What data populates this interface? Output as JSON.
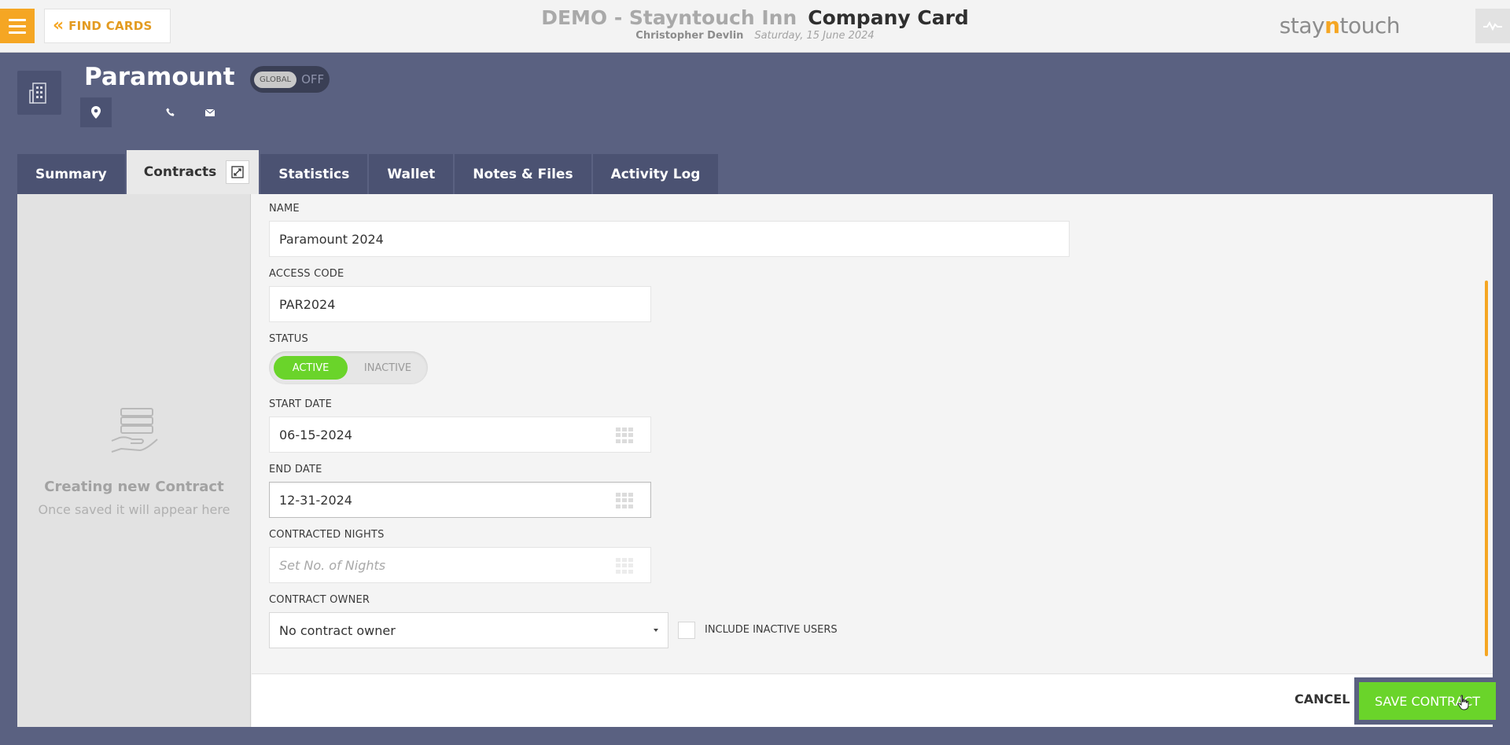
{
  "header": {
    "find_cards": "FIND CARDS",
    "hotel_name": "DEMO - Stayntouch Inn",
    "page_title": "Company Card",
    "user_name": "Christopher Devlin",
    "date": "Saturday, 15 June 2024",
    "logo_pre": "stay",
    "logo_mid": "n",
    "logo_post": "touch"
  },
  "company": {
    "name": "Paramount",
    "global_label": "GLOBAL",
    "global_state": "OFF"
  },
  "tabs": [
    {
      "label": "Summary"
    },
    {
      "label": "Contracts"
    },
    {
      "label": "Statistics"
    },
    {
      "label": "Wallet"
    },
    {
      "label": "Notes & Files"
    },
    {
      "label": "Activity Log"
    }
  ],
  "left_panel": {
    "title": "Creating new Contract",
    "subtitle": "Once saved it will appear here"
  },
  "form": {
    "name_label": "NAME",
    "name_value": "Paramount 2024",
    "access_code_label": "ACCESS CODE",
    "access_code_value": "PAR2024",
    "status_label": "STATUS",
    "status_active": "ACTIVE",
    "status_inactive": "INACTIVE",
    "start_date_label": "START DATE",
    "start_date_value": "06-15-2024",
    "end_date_label": "END DATE",
    "end_date_value": "12-31-2024",
    "nights_label": "CONTRACTED NIGHTS",
    "nights_placeholder": "Set No. of Nights",
    "owner_label": "CONTRACT OWNER",
    "owner_value": "No contract owner",
    "include_inactive_label": "INCLUDE INACTIVE USERS"
  },
  "footer": {
    "cancel": "CANCEL",
    "save": "SAVE CONTRACT"
  },
  "colors": {
    "accent": "#f5a623",
    "background": "#5a6181",
    "success": "#6ad42a"
  }
}
